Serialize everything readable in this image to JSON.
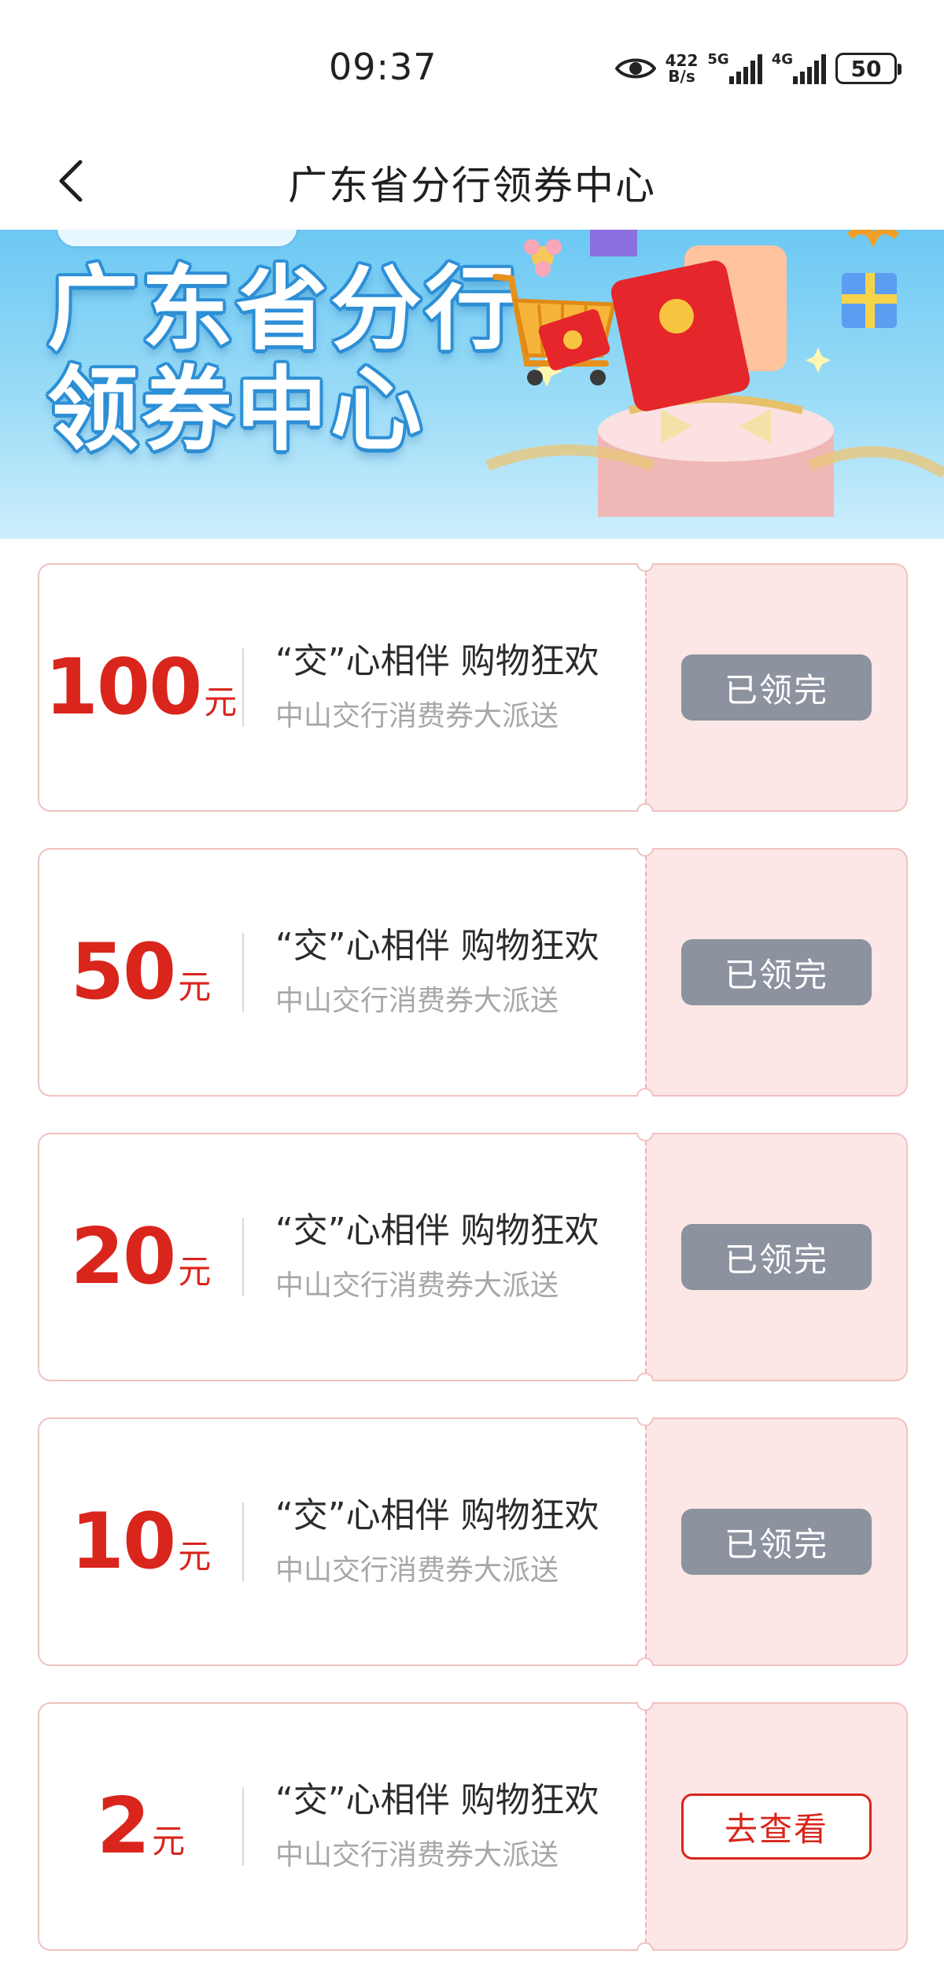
{
  "status_bar": {
    "time": "09:37",
    "net_speed_value": "422",
    "net_speed_unit": "B/s",
    "signal1_label": "5G",
    "signal2_label": "4G",
    "battery": "50",
    "icons": [
      "eye-icon",
      "signal-icon",
      "battery-icon"
    ]
  },
  "nav": {
    "title": "广东省分行领券中心",
    "back_icon": "chevron-left-icon"
  },
  "banner": {
    "title_line1": "广东省分行",
    "title_line2": "领券中心",
    "colors": {
      "sky": "#6cc8f3",
      "outline": "#2c8fd6"
    }
  },
  "coupons": [
    {
      "amount": "100",
      "unit": "元",
      "title": "“交”心相伴 购物狂欢",
      "subtitle": "中山交行消费券大派送",
      "button": "已领完",
      "state": "claimed"
    },
    {
      "amount": "50",
      "unit": "元",
      "title": "“交”心相伴 购物狂欢",
      "subtitle": "中山交行消费券大派送",
      "button": "已领完",
      "state": "claimed"
    },
    {
      "amount": "20",
      "unit": "元",
      "title": "“交”心相伴 购物狂欢",
      "subtitle": "中山交行消费券大派送",
      "button": "已领完",
      "state": "claimed"
    },
    {
      "amount": "10",
      "unit": "元",
      "title": "“交”心相伴 购物狂欢",
      "subtitle": "中山交行消费券大派送",
      "button": "已领完",
      "state": "claimed"
    },
    {
      "amount": "2",
      "unit": "元",
      "title": "“交”心相伴 购物狂欢",
      "subtitle": "中山交行消费券大派送",
      "button": "去查看",
      "state": "available"
    }
  ],
  "colors": {
    "accent": "#d9251c",
    "coupon_right_bg": "#fde6e6",
    "disabled_button": "#8c929e"
  }
}
